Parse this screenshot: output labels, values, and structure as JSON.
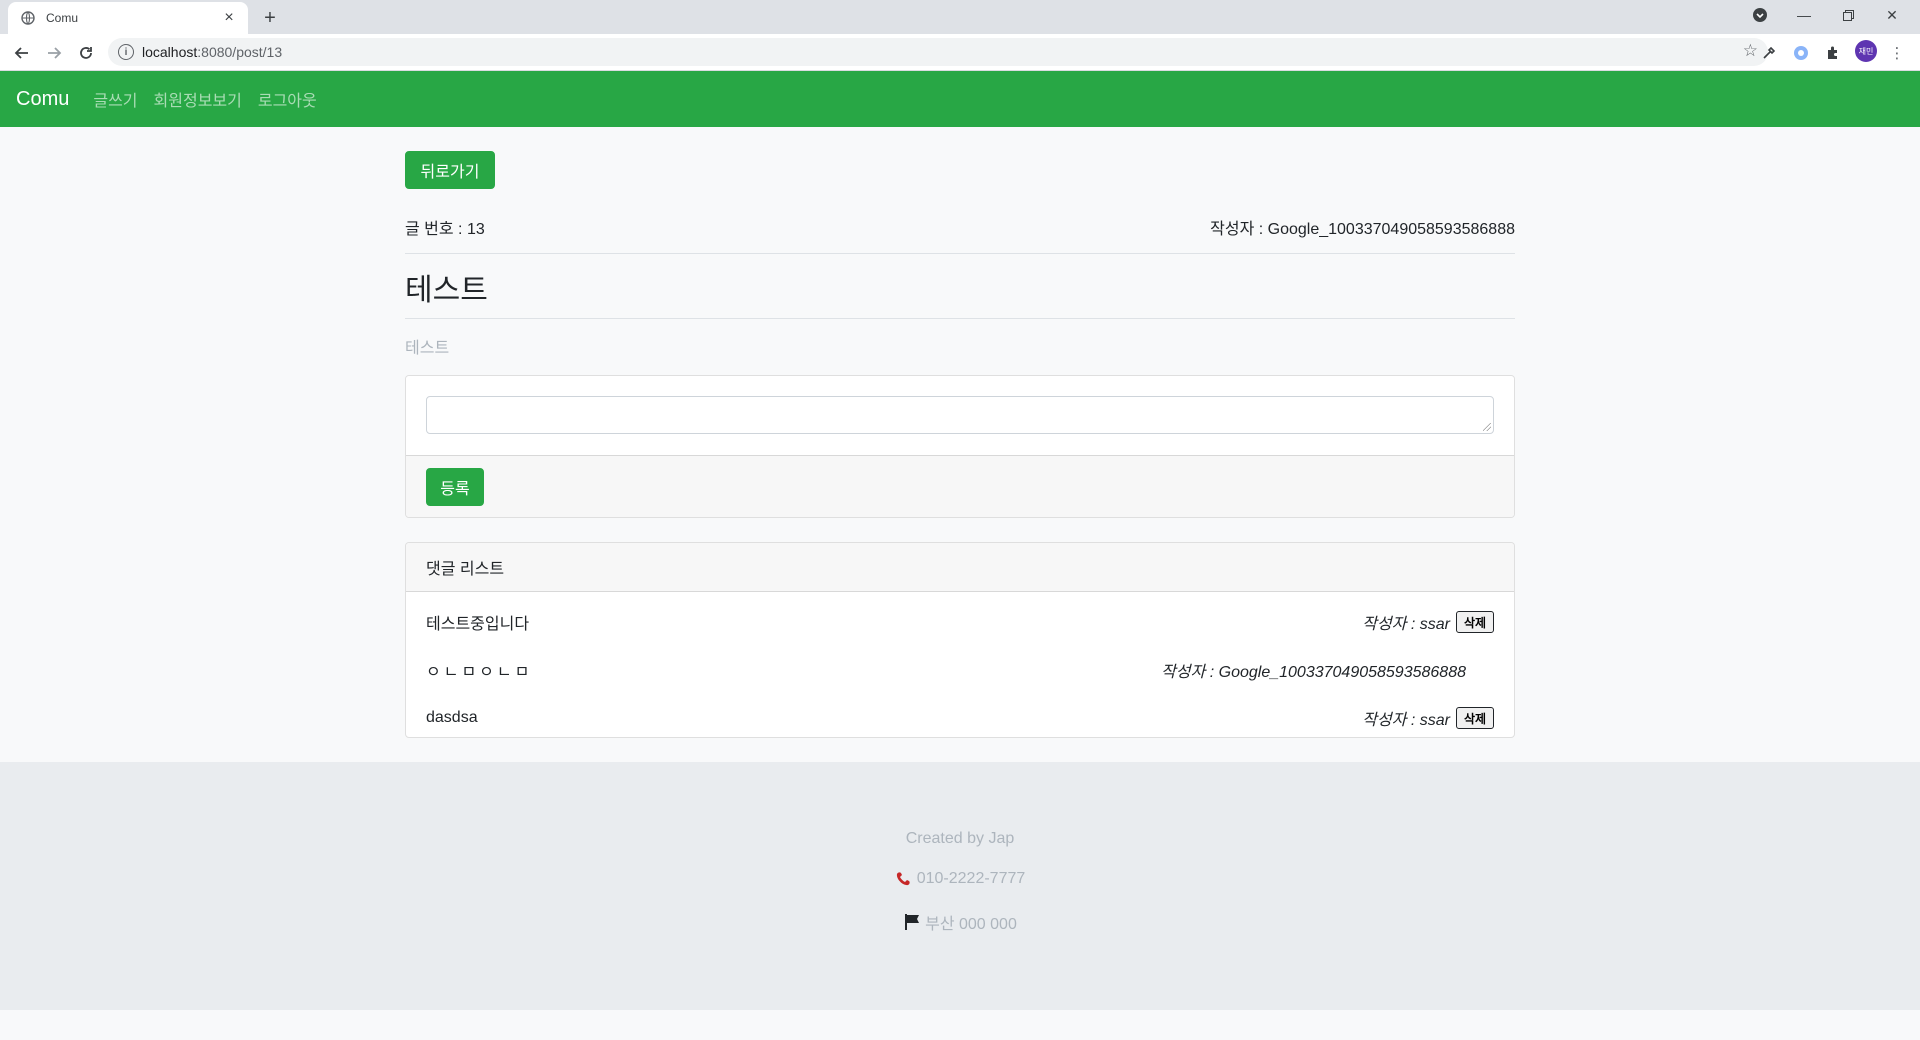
{
  "browser": {
    "tab_title": "Comu",
    "url_host": "localhost",
    "url_path": ":8080/post/13",
    "profile_initials": "재민"
  },
  "navbar": {
    "brand": "Comu",
    "links": [
      "글쓰기",
      "회원정보보기",
      "로그아웃"
    ]
  },
  "post": {
    "back_label": "뒤로가기",
    "number_label": "글 번호 : 13",
    "author_label": "작성자 : Google_100337049058593586888",
    "title": "테스트",
    "content": "테스트"
  },
  "reply": {
    "placeholder": "",
    "submit_label": "등록"
  },
  "comments": {
    "header": "댓글 리스트",
    "items": [
      {
        "content": "테스트중입니다",
        "author": "작성자 : ssar",
        "delete_label": "삭제"
      },
      {
        "content": "ㅇㄴㅁㅇㄴㅁ",
        "author": "작성자 : Google_100337049058593586888"
      },
      {
        "content": "dasdsa",
        "author": "작성자 : ssar",
        "delete_label": "삭제"
      }
    ]
  },
  "footer": {
    "created_by": "Created by Jap",
    "phone": "010-2222-7777",
    "address": "부산 000 000"
  },
  "colors": {
    "brand_green": "#28a745",
    "footer_bg": "#e9ecef"
  }
}
